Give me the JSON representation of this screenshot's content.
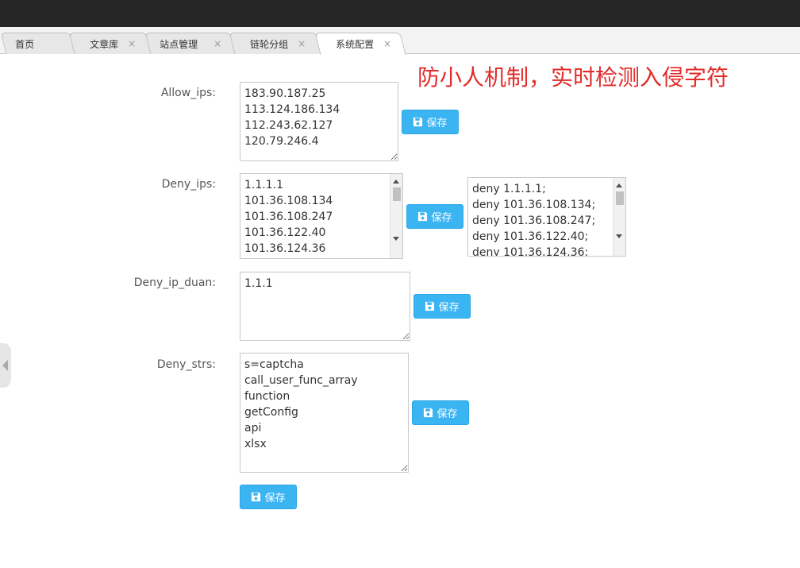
{
  "tabs": [
    {
      "label": "首页",
      "closable": false
    },
    {
      "label": "文章库",
      "closable": true
    },
    {
      "label": "站点管理",
      "closable": true
    },
    {
      "label": "链轮分组",
      "closable": true
    },
    {
      "label": "系统配置",
      "closable": true,
      "active": true
    }
  ],
  "close_glyph": "×",
  "annotation": "防小人机制，实时检测入侵字符",
  "annotation_color": "#e32b2b",
  "accent_color": "#3bb4f2",
  "save_label": "保存",
  "fields": {
    "allow_ips": {
      "label": "Allow_ips:",
      "value": "183.90.187.25\n113.124.186.134\n112.243.62.127\n120.79.246.4"
    },
    "deny_ips": {
      "label": "Deny_ips:",
      "value": "1.1.1.1\n101.36.108.134\n101.36.108.247\n101.36.122.40\n101.36.124.36"
    },
    "deny_ips_output": {
      "value": "deny 1.1.1.1;\ndeny 101.36.108.134;\ndeny 101.36.108.247;\ndeny 101.36.122.40;\ndeny 101.36.124.36;"
    },
    "deny_ip_duan": {
      "label": "Deny_ip_duan:",
      "value": "1.1.1"
    },
    "deny_strs": {
      "label": "Deny_strs:",
      "value": "s=captcha\ncall_user_func_array\nfunction\ngetConfig\napi\nxlsx"
    }
  },
  "icons": {
    "save": "floppy-disk-icon",
    "close": "close-icon",
    "side_toggle": "caret-left-icon"
  }
}
